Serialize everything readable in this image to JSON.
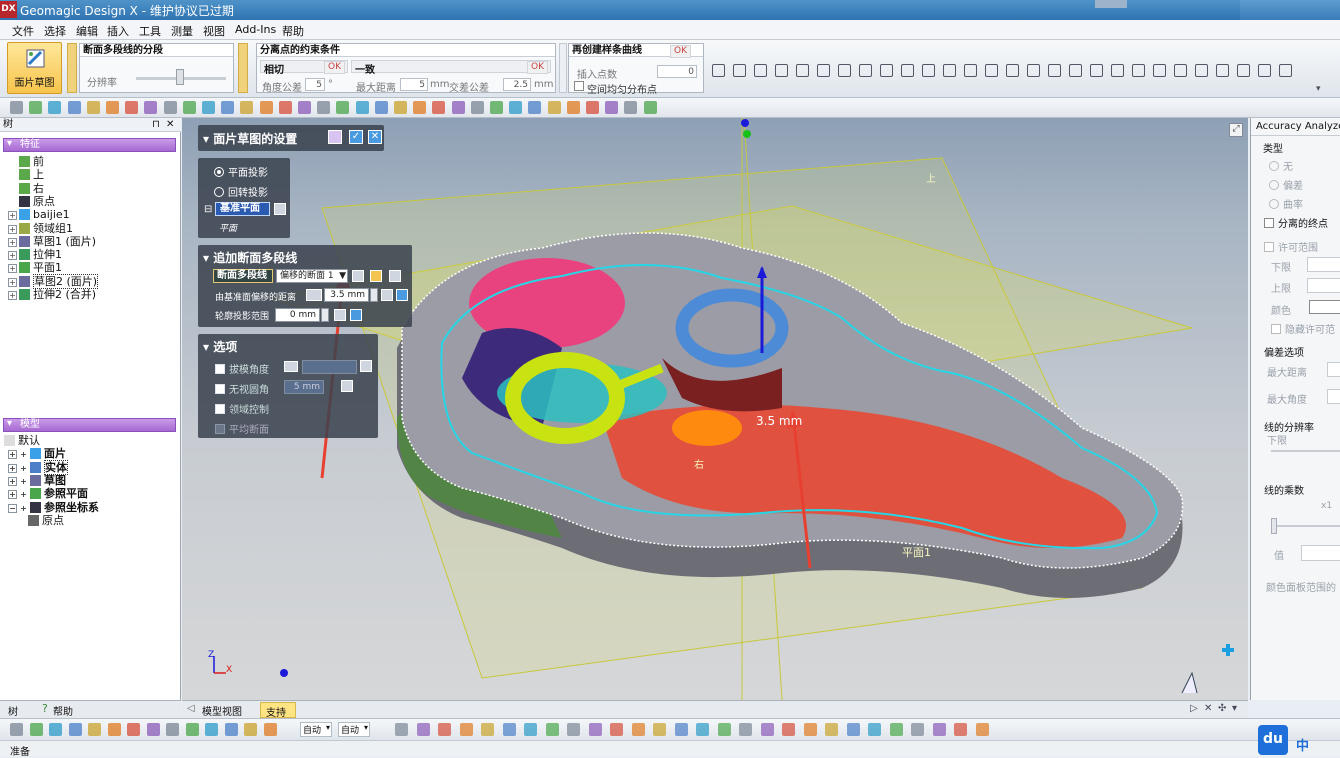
{
  "app": {
    "icon_text": "DX",
    "title": "Geomagic Design X - 维护协议已过期"
  },
  "menu": [
    "文件",
    "选择",
    "编辑",
    "插入",
    "工具",
    "测量",
    "视图",
    "Add-Ins",
    "帮助"
  ],
  "ribbon": {
    "big_button": "面片草图",
    "group1": {
      "title": "断面多段线的分段",
      "slider_label": "分辨率"
    },
    "group2": {
      "title": "分离点的约束条件",
      "sub1": "相切",
      "ok1": "OK",
      "angle_label": "角度公差",
      "angle_value": "5",
      "angle_unit": "°",
      "sub2": "一致",
      "ok2": "OK",
      "maxdist_label": "最大距离",
      "maxdist_value": "5",
      "maxdist_unit": "mm",
      "cross_label": "交差公差",
      "cross_value": "2.5",
      "cross_unit": "mm"
    },
    "group3": {
      "title": "再创建样条曲线",
      "ok": "OK",
      "insert_label": "插入点数",
      "insert_value": "0",
      "uniform_label": "空间均匀分布点"
    }
  },
  "tree": {
    "header": "树",
    "pin": "⊓",
    "close": "✕",
    "features_label": "特征",
    "features": [
      "前",
      "上",
      "右",
      "原点",
      "baijie1",
      "领域组1",
      "草图1 (面片)",
      "拉伸1",
      "平面1",
      "草图2 (面片)",
      "拉伸2 (合并)"
    ],
    "model_label": "模型",
    "model_items": [
      "默认",
      "面片",
      "实体",
      "草图",
      "参照平面",
      "参照坐标系",
      "原点"
    ]
  },
  "left_tabs": {
    "tree": "树",
    "help": "帮助"
  },
  "sketch_panel": {
    "title": "面片草图的设置",
    "opt1": "平面投影",
    "opt2": "回转投影",
    "base_plane_label": "基准平面",
    "base_plane_value": "平面",
    "section2_title": "追加断面多段线",
    "polyline_button": "断面多段线",
    "polyline_select": "偏移的断面 1",
    "offset_label": "由基准面偏移的距离",
    "offset_value": "3.5 mm",
    "range_label": "轮廓投影范围",
    "range_value": "0 mm",
    "section3_title": "选项",
    "draft_label": "拔模角度",
    "blend_label": "无视圆角",
    "blend_value": "5 mm",
    "region_label": "领域控制",
    "avg_label": "平均断面"
  },
  "viewport": {
    "plane_label_top": "上",
    "plane_label_right": "右",
    "plane1_label": "平面1",
    "dimension": "3.5 mm"
  },
  "accuracy": {
    "title": "Accuracy Analyzer(",
    "type_label": "类型",
    "r_none": "无",
    "r_dev": "偏差",
    "r_curv": "曲率",
    "separate": "分离的终点",
    "tolerance": "许可范围",
    "lower": "下限",
    "upper": "上限",
    "color": "颜色",
    "hide_tol": "隐藏许可范",
    "dev_options": "偏差选项",
    "max_dist": "最大距离",
    "max_angle": "最大角度",
    "line_res": "线的分辨率",
    "res_lower": "下限",
    "line_mult": "线的乘数",
    "mult_x1": "x1",
    "value_label": "值",
    "color_panel": "颜色面板范围的"
  },
  "bottom_tabs": {
    "model_view": "模型视图",
    "support": "支持"
  },
  "toolbar3": {
    "combo1": "自动",
    "combo2": "自动"
  },
  "status": {
    "text": "准备"
  },
  "watermark": {
    "du": "du",
    "zh": "中"
  },
  "colors": {
    "accent": "#f7c44c",
    "section": "#a56ad0",
    "title_bar": "#2f74b1"
  }
}
